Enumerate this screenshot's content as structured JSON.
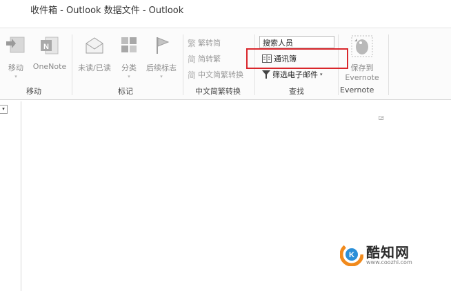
{
  "window": {
    "title": "收件箱 - Outlook 数据文件 - Outlook"
  },
  "ribbon": {
    "move_group": {
      "label": "移动",
      "move_button": "移动",
      "onenote_button": "OneNote"
    },
    "tags_group": {
      "label": "标记",
      "read_unread_button": "未读/已读",
      "categorize_button": "分类",
      "follow_up_button": "后续标志"
    },
    "chinese_conversion_group": {
      "label": "中文简繁转换",
      "to_traditional": "繁转简",
      "to_simplified": "简转繁",
      "conversion": "中文简繁转换"
    },
    "find_group": {
      "label": "查找",
      "search_people": "搜索人员",
      "address_book": "通讯簿",
      "filter_email": "筛选电子邮件"
    },
    "evernote_group": {
      "label": "Evernote",
      "save_to_line1": "保存到",
      "save_to_line2": "Evernote"
    }
  },
  "watermark": {
    "text": "酷知网",
    "url": "www.coozhi.com"
  },
  "colors": {
    "highlight": "#d9262b",
    "evernote_green": "#5a9e3a",
    "onenote_purple": "#7a3b8f"
  }
}
